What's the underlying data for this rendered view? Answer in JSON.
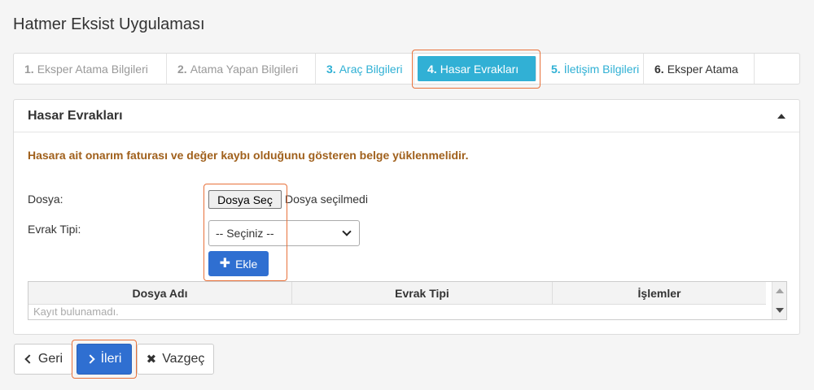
{
  "app": {
    "title": "Hatmer Eksist Uygulaması"
  },
  "steps": [
    {
      "num": "1.",
      "label": "Eksper Atama Bilgileri",
      "state": "done"
    },
    {
      "num": "2.",
      "label": "Atama Yapan Bilgileri",
      "state": "done"
    },
    {
      "num": "3.",
      "label": "Araç Bilgileri",
      "state": "link"
    },
    {
      "num": "4.",
      "label": "Hasar Evrakları",
      "state": "active"
    },
    {
      "num": "5.",
      "label": "İletişim Bilgileri",
      "state": "link"
    },
    {
      "num": "6.",
      "label": "Eksper Atama",
      "state": "dark"
    }
  ],
  "panel": {
    "title": "Hasar Evrakları",
    "warning": "Hasara ait onarım faturası ve değer kaybı olduğunu gösteren belge yüklenmelidir.",
    "file_label": "Dosya:",
    "file_button": "Dosya Seç",
    "file_status": "Dosya seçilmedi",
    "doc_type_label": "Evrak Tipi:",
    "doc_type_selected": "-- Seçiniz --",
    "add_button": "Ekle"
  },
  "table": {
    "columns": [
      "Dosya Adı",
      "Evrak Tipi",
      "İşlemler"
    ],
    "empty_text": "Kayıt bulunamadı."
  },
  "footer": {
    "back": "Geri",
    "next": "İleri",
    "cancel": "Vazgeç"
  },
  "colors": {
    "accent": "#31b0d5",
    "primary": "#2f6fd1",
    "warning_text": "#a0601c",
    "highlight": "#e8713a"
  }
}
